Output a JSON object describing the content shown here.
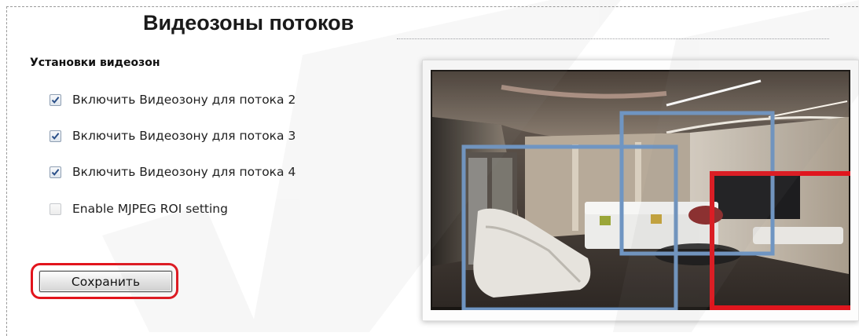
{
  "page": {
    "title": "Видеозоны потоков"
  },
  "settings": {
    "heading": "Установки видеозон",
    "options": [
      {
        "label": "Включить Видеозону для потока 2",
        "checked": true
      },
      {
        "label": "Включить Видеозону для потока 3",
        "checked": true
      },
      {
        "label": "Включить Видеозону для потока 4",
        "checked": true
      },
      {
        "label": "Enable MJPEG ROI setting",
        "checked": false
      }
    ],
    "save_label": "Сохранить"
  },
  "preview": {
    "zones": [
      {
        "kind": "stream-zone",
        "color": "#6f95c2"
      },
      {
        "kind": "stream-zone",
        "color": "#6f95c2"
      },
      {
        "kind": "stream-zone",
        "color": "#e0161e"
      }
    ]
  },
  "colors": {
    "highlight": "#e2141c",
    "zone_blue": "#6f95c2",
    "zone_red": "#e0161e",
    "checkbox_check": "#2a4f88"
  }
}
